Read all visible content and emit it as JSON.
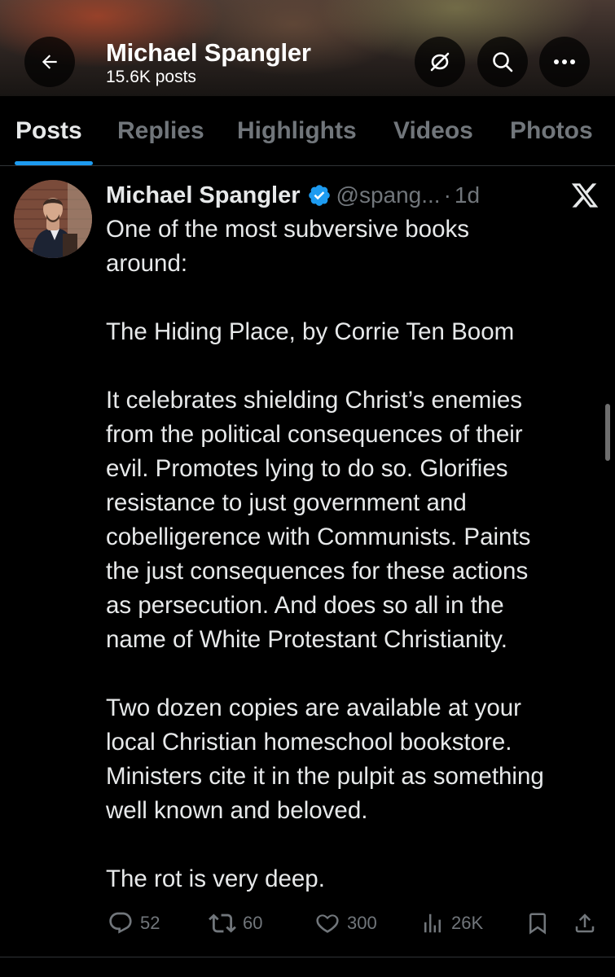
{
  "header": {
    "profile_name": "Michael Spangler",
    "post_count": "15.6K posts",
    "back_icon": "back-arrow-icon",
    "grok_icon": "grok-icon",
    "search_icon": "search-icon",
    "more_icon": "more-icon"
  },
  "tabs": [
    {
      "label": "Posts",
      "active": true
    },
    {
      "label": "Replies",
      "active": false
    },
    {
      "label": "Highlights",
      "active": false
    },
    {
      "label": "Videos",
      "active": false
    },
    {
      "label": "Photos",
      "active": false
    }
  ],
  "post": {
    "author_name": "Michael Spangler",
    "handle": "@spang...",
    "separator": "·",
    "time": "1d",
    "verified": true,
    "lines": [
      "One of the most subversive books",
      "around:",
      "",
      "The Hiding Place, by Corrie Ten Boom",
      "",
      "It celebrates shielding Christ’s enemies",
      "from the political consequences of their",
      "evil. Promotes lying to do so. Glorifies",
      "resistance to just government and",
      "cobelligerence with Communists. Paints",
      "the just consequences for these actions",
      "as persecution. And does so all in the",
      "name of White Protestant Christianity.",
      "",
      "Two dozen copies are available at your",
      "local Christian homeschool bookstore.",
      "Ministers cite it in the pulpit as something",
      "well known and beloved.",
      "",
      "The rot is very deep."
    ],
    "stats": {
      "replies": "52",
      "reposts": "60",
      "likes": "300",
      "views": "26K"
    }
  },
  "colors": {
    "accent": "#1d9bf0",
    "text": "#e7e9ea",
    "muted": "#71767b",
    "background": "#000000"
  }
}
